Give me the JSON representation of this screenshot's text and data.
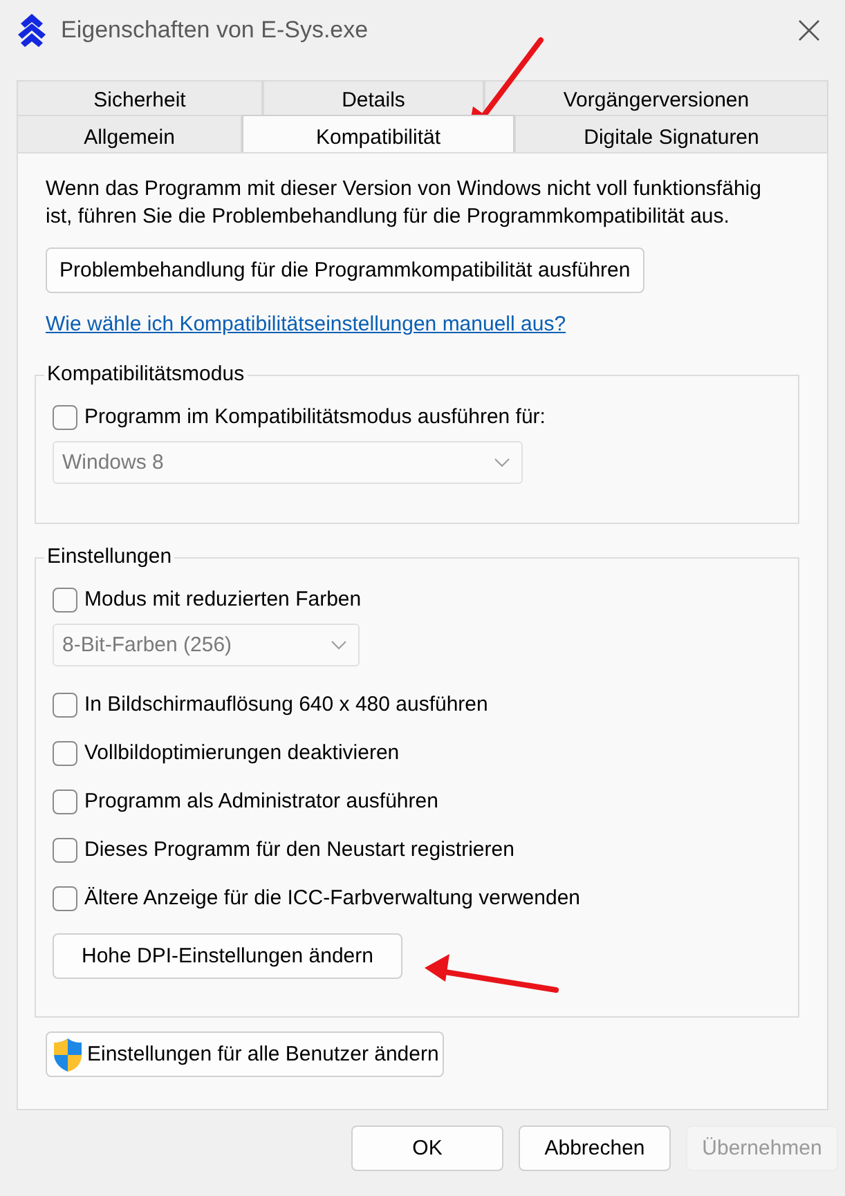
{
  "window": {
    "title": "Eigenschaften von E-Sys.exe"
  },
  "tabs": {
    "back_row": [
      {
        "label": "Sicherheit",
        "selected": false
      },
      {
        "label": "Details",
        "selected": false
      },
      {
        "label": "Vorgängerversionen",
        "selected": false
      }
    ],
    "front_row": [
      {
        "label": "Allgemein",
        "selected": false
      },
      {
        "label": "Kompatibilität",
        "selected": true
      },
      {
        "label": "Digitale Signaturen",
        "selected": false
      }
    ]
  },
  "intro": "Wenn das Programm mit dieser Version von Windows nicht voll funktionsfähig ist, führen Sie die Problembehandlung für die Programmkompatibilität aus.",
  "troubleshoot_button": "Problembehandlung für die Programmkompatibilität ausführen",
  "help_link": "Wie wähle ich Kompatibilitätseinstellungen manuell aus?",
  "compat_group": {
    "title": "Kompatibilitätsmodus",
    "items": [
      {
        "kind": "checkbox",
        "label": "Programm im Kompatibilitätsmodus ausführen für:",
        "checked": false
      },
      {
        "kind": "dropdown",
        "value": "Windows 8",
        "disabled": true
      }
    ]
  },
  "settings_group": {
    "title": "Einstellungen",
    "items": [
      {
        "kind": "checkbox",
        "label": "Modus mit reduzierten Farben",
        "checked": false
      },
      {
        "kind": "dropdown",
        "value": "8-Bit-Farben (256)",
        "disabled": true
      },
      {
        "kind": "checkbox",
        "label": "In Bildschirmauflösung 640 x 480 ausführen",
        "checked": false
      },
      {
        "kind": "checkbox",
        "label": "Vollbildoptimierungen deaktivieren",
        "checked": false
      },
      {
        "kind": "checkbox",
        "label": "Programm als Administrator ausführen",
        "checked": false
      },
      {
        "kind": "checkbox",
        "label": "Dieses Programm für den Neustart registrieren",
        "checked": false
      },
      {
        "kind": "checkbox",
        "label": "Ältere Anzeige für die ICC-Farbverwaltung verwenden",
        "checked": false
      },
      {
        "kind": "button",
        "label": "Hohe DPI-Einstellungen ändern"
      }
    ]
  },
  "all_users_button": "Einstellungen für alle Benutzer ändern",
  "buttons": [
    {
      "label": "OK",
      "disabled": false
    },
    {
      "label": "Abbrechen",
      "disabled": false
    },
    {
      "label": "Übernehmen",
      "disabled": true
    }
  ]
}
